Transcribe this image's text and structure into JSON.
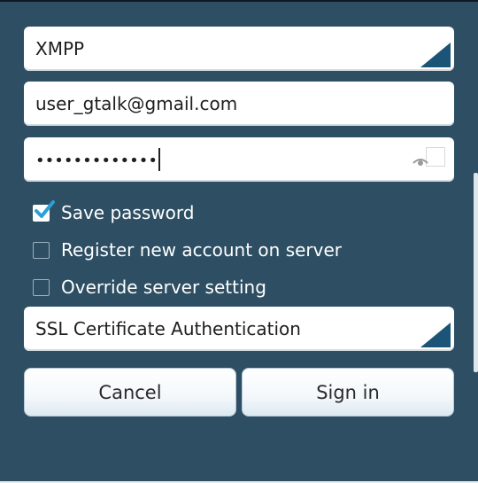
{
  "account_form": {
    "account_type": {
      "value": "XMPP"
    },
    "username": {
      "value": "user_gtalk@gmail.com"
    },
    "password": {
      "masked_value": "•••••••••••••"
    },
    "options": [
      {
        "label": "Save password",
        "checked": true
      },
      {
        "label": "Register new account on server",
        "checked": false
      },
      {
        "label": "Override server setting",
        "checked": false
      }
    ],
    "security": {
      "value": "SSL Certificate Authentication"
    },
    "buttons": {
      "cancel_label": "Cancel",
      "signin_label": "Sign in"
    }
  },
  "icons": {
    "spinner_arrow": "dropdown-corner-triangle-icon",
    "password_toggle": "show-password-icon",
    "checkmark": "checkmark-icon"
  },
  "colors": {
    "background": "#2d4e63",
    "accent": "#1b5476",
    "checkmark": "#2a9fd8"
  }
}
